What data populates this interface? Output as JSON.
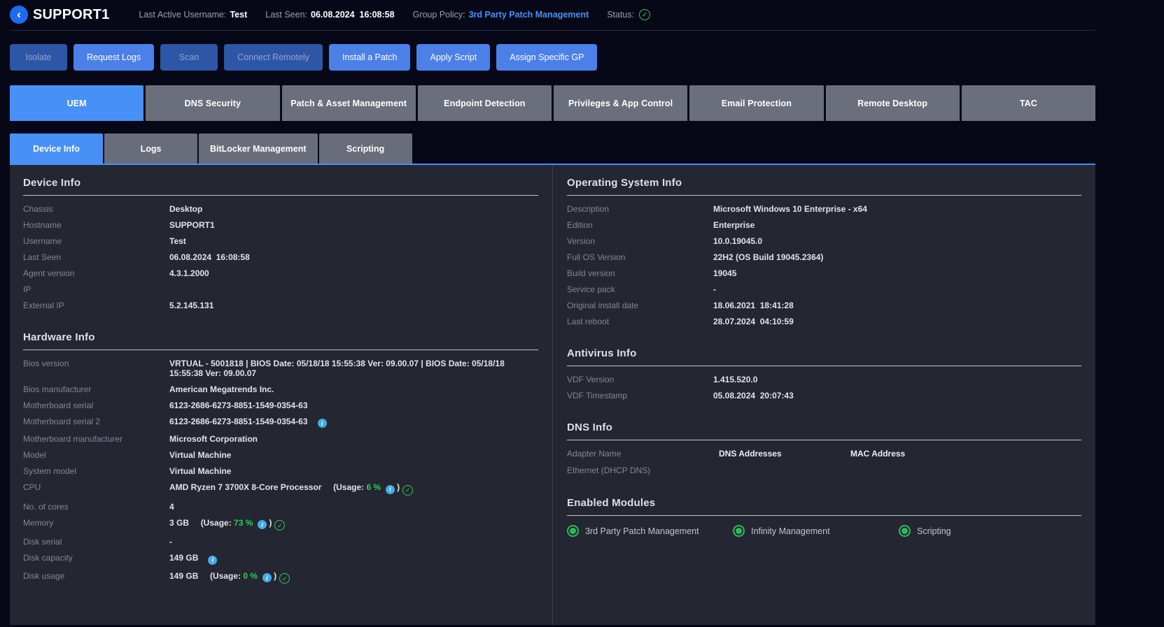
{
  "colors": {
    "accent_blue": "#4791f6",
    "button_blue": "#4b80e8",
    "disabled_blue": "#2e56a6",
    "green": "#2fcb5a",
    "info_blue": "#41aee6",
    "panel_bg": "#242631",
    "page_bg": "#060818"
  },
  "icons": {
    "back_chevron": "‹",
    "check": "✓",
    "info": "i"
  },
  "header": {
    "title": "SUPPORT1",
    "username_label": "Last Active Username:",
    "username": "Test",
    "last_seen_label": "Last Seen:",
    "last_seen": "06.08.2024  16:08:58",
    "group_policy_label": "Group Policy:",
    "group_policy": "3rd Party Patch Management",
    "status_label": "Status:"
  },
  "actions": [
    {
      "label": "Isolate",
      "enabled": false
    },
    {
      "label": "Request Logs",
      "enabled": true
    },
    {
      "label": "Scan",
      "enabled": false
    },
    {
      "label": "Connect Remotely",
      "enabled": false
    },
    {
      "label": "Install a Patch",
      "enabled": true
    },
    {
      "label": "Apply Script",
      "enabled": true
    },
    {
      "label": "Assign Specific GP",
      "enabled": true
    }
  ],
  "main_tabs": [
    {
      "label": "UEM",
      "active": true
    },
    {
      "label": "DNS Security",
      "active": false
    },
    {
      "label": "Patch & Asset Management",
      "active": false
    },
    {
      "label": "Endpoint Detection",
      "active": false
    },
    {
      "label": "Privileges & App Control",
      "active": false
    },
    {
      "label": "Email Protection",
      "active": false
    },
    {
      "label": "Remote Desktop",
      "active": false
    },
    {
      "label": "TAC",
      "active": false
    }
  ],
  "sub_tabs": [
    {
      "label": "Device Info",
      "active": true
    },
    {
      "label": "Logs",
      "active": false
    },
    {
      "label": "BitLocker Management",
      "active": false
    },
    {
      "label": "Scripting",
      "active": false
    }
  ],
  "usage_open": "(Usage:",
  "usage_close": ")",
  "device_info": {
    "title": "Device Info",
    "rows": [
      {
        "label": "Chassis",
        "value": "Desktop"
      },
      {
        "label": "Hostname",
        "value": "SUPPORT1"
      },
      {
        "label": "Username",
        "value": "Test"
      },
      {
        "label": "Last Seen",
        "value": "06.08.2024  16:08:58"
      },
      {
        "label": "Agent version",
        "value": "4.3.1.2000"
      },
      {
        "label": "IP",
        "value": ""
      },
      {
        "label": "External IP",
        "value": "5.2.145.131"
      }
    ]
  },
  "hardware_info": {
    "title": "Hardware Info",
    "rows": [
      {
        "label": "Bios version",
        "value": "VRTUAL - 5001818 | BIOS Date: 05/18/18 15:55:38 Ver: 09.00.07 | BIOS Date: 05/18/18 15:55:38 Ver: 09.00.07"
      },
      {
        "label": "Bios manufacturer",
        "value": "American Megatrends Inc."
      },
      {
        "label": "Motherboard serial",
        "value": "6123-2686-6273-8851-1549-0354-63"
      },
      {
        "label": "Motherboard serial 2",
        "value": "6123-2686-6273-8851-1549-0354-63",
        "info": true
      },
      {
        "label": "Motherboard manufacturer",
        "value": "Microsoft Corporation"
      },
      {
        "label": "Model",
        "value": "Virtual Machine"
      },
      {
        "label": "System model",
        "value": "Virtual Machine"
      },
      {
        "label": "CPU",
        "value": "AMD Ryzen 7 3700X 8-Core Processor",
        "usage": "6 %",
        "check": true
      },
      {
        "label": "No. of cores",
        "value": "4"
      },
      {
        "label": "Memory",
        "value": "3 GB",
        "usage": "73 %",
        "check": true
      },
      {
        "label": "Disk serial",
        "value": "-"
      },
      {
        "label": "Disk capacity",
        "value": "149 GB",
        "info": true
      },
      {
        "label": "Disk usage",
        "value": "149 GB",
        "usage": "0 %",
        "check": true
      }
    ]
  },
  "os_info": {
    "title": "Operating System Info",
    "rows": [
      {
        "label": "Description",
        "value": "Microsoft Windows 10 Enterprise - x64"
      },
      {
        "label": "Edition",
        "value": "Enterprise"
      },
      {
        "label": "Version",
        "value": "10.0.19045.0"
      },
      {
        "label": "Full OS Version",
        "value": "22H2 (OS Build 19045.2364)"
      },
      {
        "label": "Build version",
        "value": "19045"
      },
      {
        "label": "Service pack",
        "value": "-"
      },
      {
        "label": "Original install date",
        "value": "18.06.2021  18:41:28"
      },
      {
        "label": "Last reboot",
        "value": "28.07.2024  04:10:59"
      }
    ]
  },
  "antivirus_info": {
    "title": "Antivirus Info",
    "rows": [
      {
        "label": "VDF Version",
        "value": "1.415.520.0"
      },
      {
        "label": "VDF Timestamp",
        "value": "05.08.2024  20:07:43"
      }
    ]
  },
  "dns_info": {
    "title": "DNS Info",
    "columns": [
      "Adapter Name",
      "DNS Addresses",
      "MAC Address"
    ],
    "rows": [
      {
        "adapter": "Ethernet (DHCP DNS)",
        "dns": "",
        "mac": ""
      }
    ]
  },
  "enabled_modules": {
    "title": "Enabled Modules",
    "items": [
      "3rd Party Patch Management",
      "Infinity Management",
      "Scripting"
    ]
  }
}
